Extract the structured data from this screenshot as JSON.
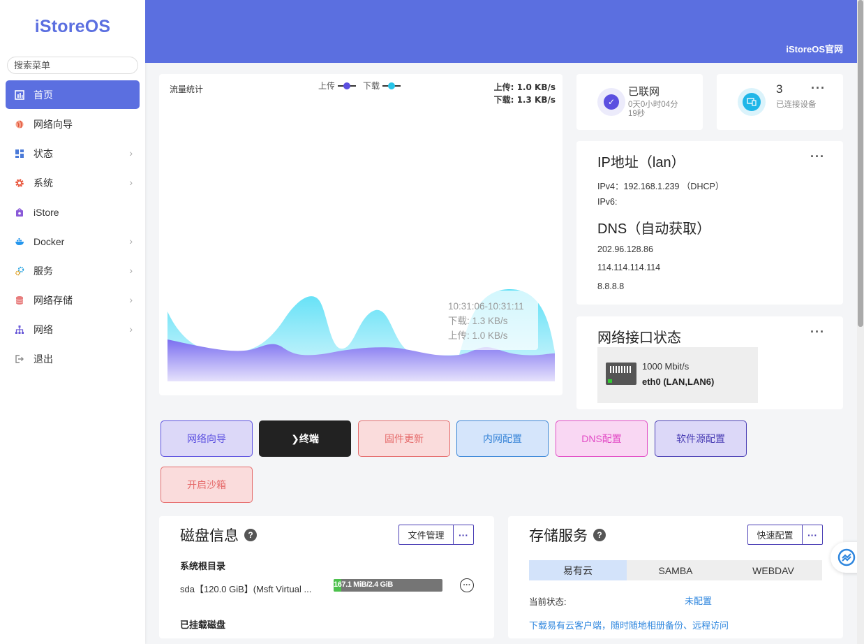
{
  "sidebar": {
    "logo": "iStoreOS",
    "search_placeholder": "搜索菜单",
    "items": [
      {
        "label": "首页",
        "icon": "dashboard-icon",
        "active": true
      },
      {
        "label": "网络向导",
        "icon": "globe-icon"
      },
      {
        "label": "状态",
        "icon": "grid-icon",
        "has_children": true
      },
      {
        "label": "系统",
        "icon": "gear-icon",
        "has_children": true
      },
      {
        "label": "iStore",
        "icon": "store-icon"
      },
      {
        "label": "Docker",
        "icon": "docker-icon",
        "has_children": true
      },
      {
        "label": "服务",
        "icon": "services-icon",
        "has_children": true
      },
      {
        "label": "网络存储",
        "icon": "storage-icon",
        "has_children": true
      },
      {
        "label": "网络",
        "icon": "network-icon",
        "has_children": true
      },
      {
        "label": "退出",
        "icon": "logout-icon"
      }
    ]
  },
  "header": {
    "link": "iStoreOS官网"
  },
  "traffic": {
    "title": "流量统计",
    "legend_up": "上传",
    "legend_down": "下载",
    "rate_up": "上传: 1.0 KB/s",
    "rate_down": "下载: 1.3 KB/s",
    "tooltip_time": "10:31:06-10:31:11",
    "tooltip_down": "下载: 1.3 KB/s",
    "tooltip_up": "上传: 1.0 KB/s"
  },
  "colors": {
    "accent": "#5b6fe0",
    "upload": "#5b4fe0",
    "download": "#28c4e8"
  },
  "net_status": {
    "title": "已联网",
    "uptime": "0天0小时04分19秒"
  },
  "devices": {
    "count": "3",
    "label": "已连接设备"
  },
  "ip": {
    "title": "IP地址（lan）",
    "ipv4": "IPv4：192.168.1.239 （DHCP）",
    "ipv6": "IPv6:",
    "dns_title": "DNS（自动获取）",
    "dns": [
      "202.96.128.86",
      "114.114.114.114",
      "8.8.8.8"
    ]
  },
  "iface": {
    "title": "网络接口状态",
    "speed": "1000 Mbit/s",
    "name": "eth0 (LAN,LAN6)"
  },
  "quick_buttons": [
    {
      "label": "网络向导"
    },
    {
      "label": "❯终端"
    },
    {
      "label": "固件更新"
    },
    {
      "label": "内网配置"
    },
    {
      "label": "DNS配置"
    },
    {
      "label": "软件源配置"
    },
    {
      "label": "开启沙箱"
    }
  ],
  "disk": {
    "title": "磁盘信息",
    "file_btn": "文件管理",
    "root_label": "系统根目录",
    "device": "sda【120.0 GiB】(Msft Virtual ...",
    "usage_text": "167.1 MiB/2.4 GiB",
    "usage_fraction": 0.068,
    "mounted_label": "已挂载磁盘"
  },
  "storage": {
    "title": "存储服务",
    "config_btn": "快速配置",
    "tabs": [
      "易有云",
      "SAMBA",
      "WEBDAV"
    ],
    "status_label": "当前状态:",
    "status_value": "未配置",
    "link": "下载易有云客户端，随时随地相册备份、远程访问"
  }
}
